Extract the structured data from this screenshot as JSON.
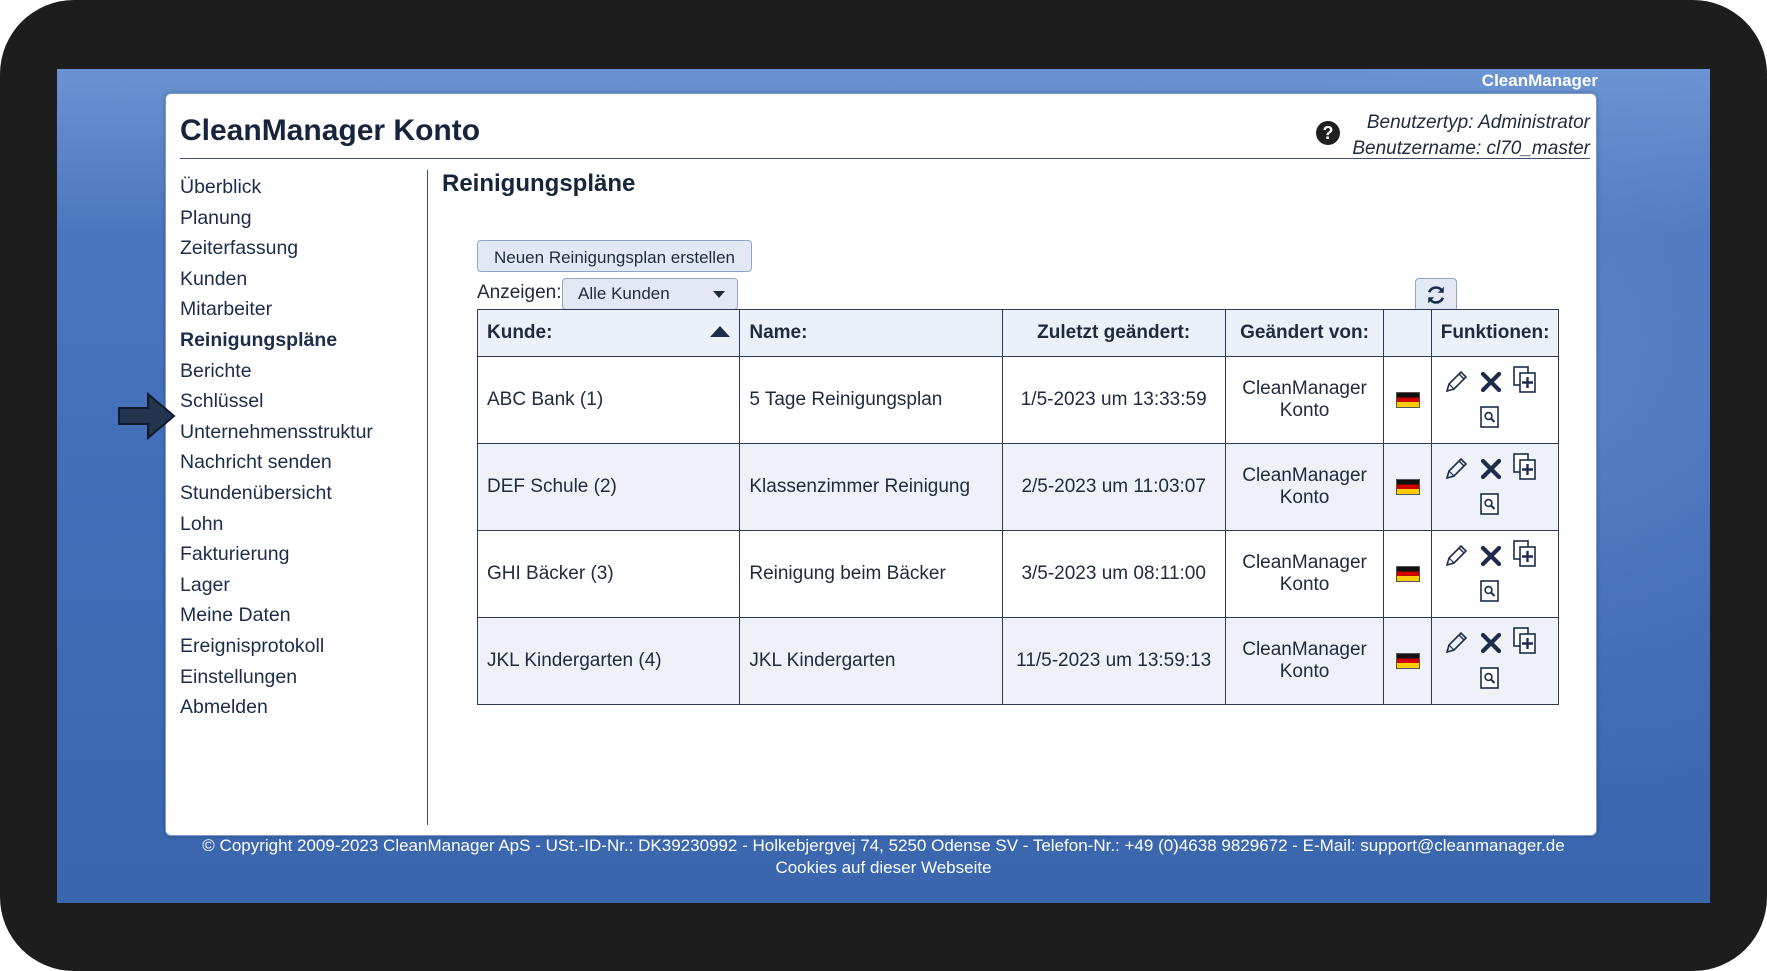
{
  "brand": "CleanManager",
  "header": {
    "title": "CleanManager Konto",
    "help_icon": "question-circle-icon",
    "user_type": "Benutzertyp: Administrator",
    "user_name": "Benutzername: cl70_master"
  },
  "sidebar": {
    "active_index": 5,
    "items": [
      {
        "label": "Überblick"
      },
      {
        "label": "Planung"
      },
      {
        "label": "Zeiterfassung"
      },
      {
        "label": "Kunden"
      },
      {
        "label": "Mitarbeiter"
      },
      {
        "label": "Reinigungspläne"
      },
      {
        "label": "Berichte"
      },
      {
        "label": "Schlüssel"
      },
      {
        "label": "Unternehmensstruktur"
      },
      {
        "label": "Nachricht senden"
      },
      {
        "label": "Stundenübersicht"
      },
      {
        "label": "Lohn"
      },
      {
        "label": "Fakturierung"
      },
      {
        "label": "Lager"
      },
      {
        "label": "Meine Daten"
      },
      {
        "label": "Ereignisprotokoll"
      },
      {
        "label": "Einstellungen"
      },
      {
        "label": "Abmelden"
      }
    ]
  },
  "main": {
    "title": "Reinigungspläne",
    "new_button_label": "Neuen Reinigungsplan erstellen",
    "filter_label": "Anzeigen:",
    "filter_value": "Alle Kunden",
    "refresh_icon": "refresh-icon",
    "table": {
      "headers": {
        "customer": "Kunde:",
        "name": "Name:",
        "modified": "Zuletzt geändert:",
        "modified_by": "Geändert von:",
        "language": "",
        "functions": "Funktionen:"
      },
      "sort": {
        "column": "customer",
        "direction": "ascending"
      },
      "rows": [
        {
          "customer": "ABC Bank (1)",
          "name": "5 Tage Reinigungsplan",
          "modified": "1/5-2023 um 13:33:59",
          "modified_by_1": "CleanManager",
          "modified_by_2": "Konto",
          "language_icon": "german-flag-icon"
        },
        {
          "customer": "DEF Schule (2)",
          "name": "Klassenzimmer Reinigung",
          "modified": "2/5-2023 um 11:03:07",
          "modified_by_1": "CleanManager",
          "modified_by_2": "Konto",
          "language_icon": "german-flag-icon"
        },
        {
          "customer": "GHI Bäcker (3)",
          "name": "Reinigung beim Bäcker",
          "modified": "3/5-2023 um 08:11:00",
          "modified_by_1": "CleanManager",
          "modified_by_2": "Konto",
          "language_icon": "german-flag-icon"
        },
        {
          "customer": "JKL Kindergarten (4)",
          "name": "JKL Kindergarten",
          "modified": "11/5-2023 um 13:59:13",
          "modified_by_1": "CleanManager",
          "modified_by_2": "Konto",
          "language_icon": "german-flag-icon"
        }
      ],
      "function_icons": [
        "edit-pencil-icon",
        "delete-x-icon",
        "copy-plus-icon",
        "preview-magnifier-icon"
      ]
    }
  },
  "footer": {
    "copyright": "© Copyright 2009-2023 CleanManager ApS - USt.-ID-Nr.: DK39230992 - Holkebjergvej 74, 5250 Odense SV - Telefon-Nr.: +49 (0)4638 9829672 - E-Mail: support@cleanmanager.de",
    "cookies": "Cookies auf dieser Webseite"
  },
  "colors": {
    "background_blue": "#4a76bd",
    "text_dark": "#16243c",
    "button_bg": "#e2e9f4"
  }
}
